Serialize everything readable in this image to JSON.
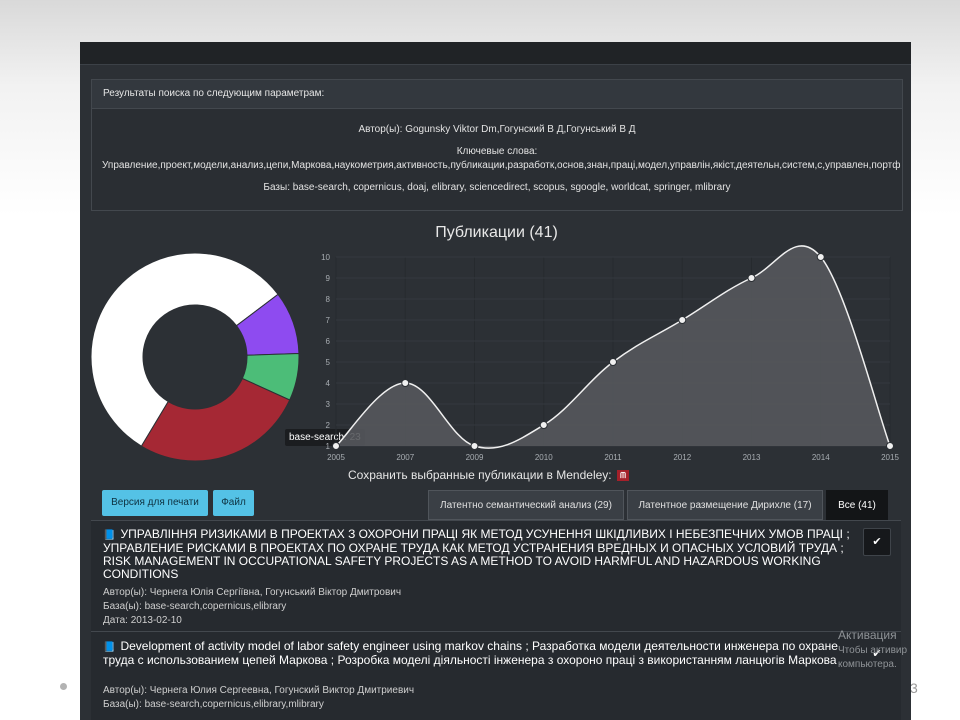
{
  "search_panel": {
    "header": "Результаты поиска по следующим параметрам:",
    "authors": "Автор(ы): Gogunsky Viktor Dm,Гогунский В Д,Гогунський В Д",
    "keywords_label": "Ключевые слова:",
    "keywords": "Управление,проект,модели,анализ,цепи,Маркова,наукометрия,активность,публикации,разработк,основ,знан,праці,модел,управлін,якіст,деятельн,систем,с,управлен,портф",
    "bases": "Базы: base-search, copernicus, doaj, elibrary, sciencedirect, scopus, sgoogle, worldcat, springer, mlibrary"
  },
  "chart_title": "Публикации (41)",
  "tooltip": "base-search: 23",
  "chart_data": [
    {
      "type": "pie",
      "values": [
        23,
        4,
        3,
        11
      ],
      "labels": [
        "base-search",
        "",
        "",
        ""
      ],
      "colors": [
        "#ffffff",
        "#8e4bf0",
        "#4cbd78",
        "#a52834"
      ]
    },
    {
      "type": "area",
      "x": [
        "2005",
        "2007",
        "2009",
        "2010",
        "2011",
        "2012",
        "2013",
        "2014",
        "2015"
      ],
      "values": [
        1,
        4,
        1,
        2,
        5,
        7,
        9,
        10,
        1
      ],
      "ylim": [
        1,
        10
      ],
      "yticks": [
        "1",
        "2",
        "3",
        "4",
        "5",
        "6",
        "7",
        "8",
        "9",
        "10"
      ],
      "xticks": [
        "2005",
        "2007",
        "2009",
        "2010",
        "2011",
        "2012",
        "2013",
        "2014",
        "2015"
      ],
      "grid": true
    }
  ],
  "mendeley": {
    "label": "Сохранить выбранные публикации в Mendeley:",
    "icon": "m-icon"
  },
  "buttons": {
    "print": "Версия для печати",
    "file": "Файл"
  },
  "tabs": [
    {
      "label": "Латентно семантический анализ (29)",
      "active": false
    },
    {
      "label": "Латентное размещение Дирихле (17)",
      "active": false
    },
    {
      "label": "Все (41)",
      "active": true
    }
  ],
  "publications": [
    {
      "title": "УПРАВЛІННЯ РИЗИКАМИ В ПРОЕКТАХ З ОХОРОНИ ПРАЦІ ЯК МЕТОД УСУНЕННЯ ШКІДЛИВИХ І НЕБЕЗПЕЧНИХ УМОВ ПРАЦІ ; УПРАВЛЕНИЕ РИСКАМИ В ПРОЕКТАХ ПО ОХРАНЕ ТРУДА КАК МЕТОД УСТРАНЕНИЯ ВРЕДНЫХ И ОПАСНЫХ УСЛОВИЙ ТРУДА ; RISK MANAGEMENT IN OCCUPATIONAL SAFETY PROJECTS AS A METHOD TO AVOID HARMFUL AND HAZARDOUS WORKING CONDITIONS",
      "authors": "Автор(ы): Чернега Юлія Сергіївна, Гогунський Віктор Дмитрович",
      "bases": "База(ы): base-search,copernicus,elibrary",
      "date": "Дата: 2013-02-10"
    },
    {
      "title": "Development of activity model of labor safety engineer using markov chains ; Разработка модели деятельности инженера по охране труда с использованием цепей Маркова ; Розробка моделі діяльності інженера з охороно праці з використанням ланцюгів Маркова",
      "authors": "Автор(ы): Чернега Юлия Сергеевна, Гогунский Виктор Дмитриевич",
      "bases": "База(ы): base-search,copernicus,elibrary,mlibrary"
    }
  ],
  "watermark": {
    "title": "Активация",
    "line1": "Чтобы активир",
    "line2": "компьютера."
  },
  "page_number": "3"
}
